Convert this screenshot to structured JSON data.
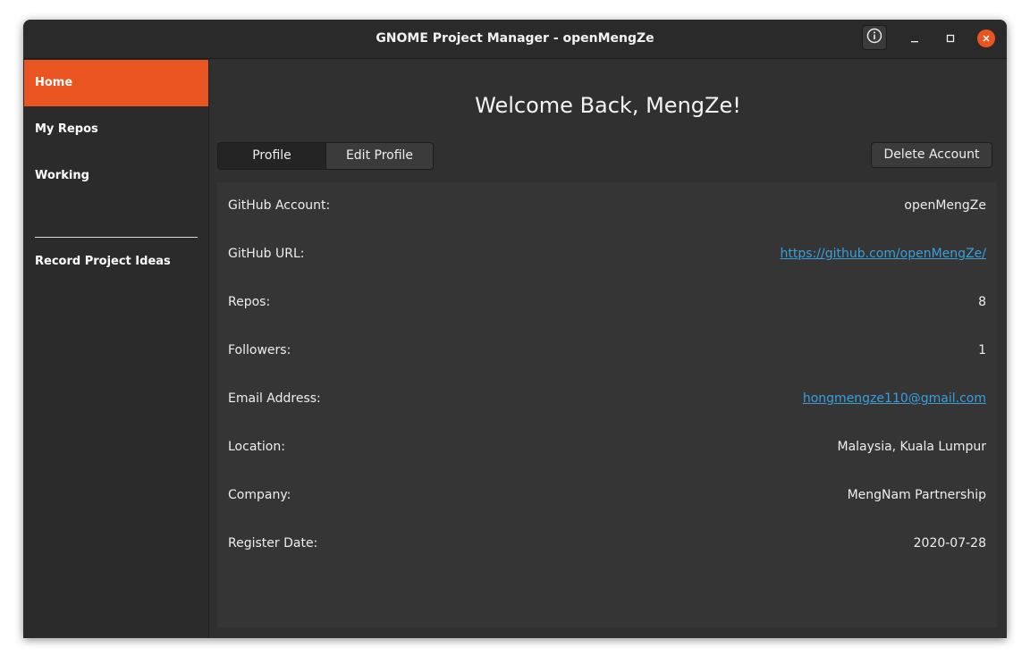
{
  "window": {
    "title": "GNOME Project Manager - openMengZe",
    "controls": {
      "info_icon": "info-icon",
      "minimize_icon": "minimize-icon",
      "maximize_icon": "maximize-icon",
      "close_icon": "close-icon"
    }
  },
  "sidebar": {
    "items": [
      {
        "label": "Home",
        "active": true
      },
      {
        "label": "My Repos",
        "active": false
      },
      {
        "label": "Working",
        "active": false
      },
      {
        "label": "Record Project Ideas",
        "active": false
      }
    ]
  },
  "main": {
    "welcome": "Welcome Back, MengZe!",
    "tabs": [
      {
        "label": "Profile",
        "active": true
      },
      {
        "label": "Edit Profile",
        "active": false
      }
    ],
    "delete_label": "Delete Account",
    "profile_rows": [
      {
        "label": "GitHub Account:",
        "value": "openMengZe",
        "link": false
      },
      {
        "label": "GitHub URL:",
        "value": "https://github.com/openMengZe/",
        "link": true
      },
      {
        "label": "Repos:",
        "value": "8",
        "link": false
      },
      {
        "label": "Followers:",
        "value": "1",
        "link": false
      },
      {
        "label": "Email Address:",
        "value": "hongmengze110@gmail.com",
        "link": true
      },
      {
        "label": "Location:",
        "value": "Malaysia, Kuala Lumpur",
        "link": false
      },
      {
        "label": "Company:",
        "value": "MengNam Partnership",
        "link": false
      },
      {
        "label": "Register Date:",
        "value": "2020-07-28",
        "link": false
      }
    ]
  },
  "colors": {
    "accent": "#e95420",
    "link": "#3a9fd8",
    "background": "#303030"
  }
}
